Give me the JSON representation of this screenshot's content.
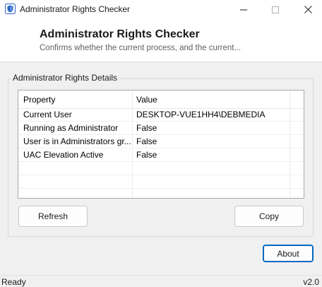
{
  "window": {
    "title": "Administrator Rights Checker",
    "minimize_glyph": "—",
    "maximize_glyph": "☐",
    "close_glyph": "✕"
  },
  "header": {
    "title": "Administrator Rights Checker",
    "subtitle": "Confirms whether the current process, and the current..."
  },
  "group": {
    "label": "Administrator Rights Details"
  },
  "table": {
    "columns": [
      "Property",
      "Value"
    ],
    "rows": [
      [
        "Current User",
        "DESKTOP-VUE1HH4\\DEBMEDIA"
      ],
      [
        "Running as Administrator",
        "False"
      ],
      [
        "User is in Administrators gr...",
        "False"
      ],
      [
        "UAC Elevation Active",
        "False"
      ]
    ]
  },
  "buttons": {
    "refresh": "Refresh",
    "copy": "Copy",
    "about": "About"
  },
  "status": {
    "left": "Ready",
    "right": "v2.0"
  },
  "colors": {
    "accent": "#0067c0",
    "icon_blue": "#2b63c7"
  }
}
